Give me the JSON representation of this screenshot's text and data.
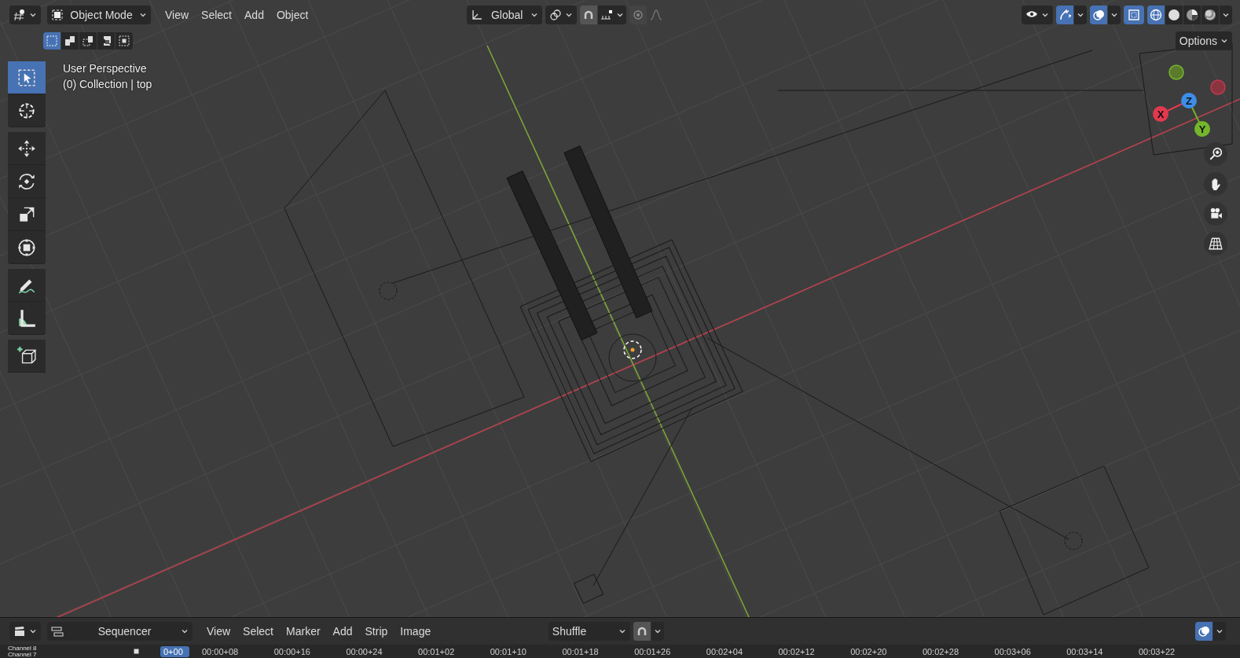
{
  "viewport_header": {
    "mode": "Object Mode",
    "menus": [
      "View",
      "Select",
      "Add",
      "Object"
    ],
    "orientation": "Global",
    "select_modes": [
      {
        "kind": "new",
        "selected": true
      },
      {
        "kind": "extend",
        "selected": false
      },
      {
        "kind": "subtract",
        "selected": false
      },
      {
        "kind": "invert",
        "selected": false
      },
      {
        "kind": "intersect",
        "selected": false
      }
    ],
    "toggles": [
      {
        "kind": "gizmos",
        "on": true
      },
      {
        "kind": "overlays",
        "on": true
      },
      {
        "kind": "xray",
        "on": true
      }
    ],
    "shading": [
      {
        "kind": "wireframe",
        "selected": true
      },
      {
        "kind": "solid",
        "selected": false
      },
      {
        "kind": "material",
        "selected": false
      },
      {
        "kind": "rendered",
        "selected": false
      }
    ],
    "options": "Options"
  },
  "tools": [
    {
      "kind": "select-box",
      "selected": true
    },
    {
      "kind": "cursor",
      "selected": false
    },
    {
      "kind": "move",
      "selected": false
    },
    {
      "kind": "rotate",
      "selected": false
    },
    {
      "kind": "scale",
      "selected": false
    },
    {
      "kind": "transform",
      "selected": false
    },
    {
      "kind": "annotate",
      "selected": false
    },
    {
      "kind": "measure",
      "selected": false
    },
    {
      "kind": "add-cube",
      "selected": false
    }
  ],
  "viewport_info": [
    "User Perspective",
    "(0) Collection | top"
  ],
  "gizmo_axes": [
    {
      "label": "X",
      "color": "#e2394f"
    },
    {
      "label": "Z",
      "color": "#3c8ee8"
    },
    {
      "label": "Y",
      "color": "#74b62c"
    }
  ],
  "sequencer_header": {
    "editor": "Sequencer",
    "menus": [
      "View",
      "Select",
      "Marker",
      "Add",
      "Strip",
      "Image"
    ],
    "snap_mode": "Shuffle",
    "overlays_on": true
  },
  "timeline": {
    "channels": [
      "Channel 8",
      "Channel 7"
    ],
    "current_frame": "0+00",
    "ticks": [
      "00:00+08",
      "00:00+16",
      "00:00+24",
      "00:01+02",
      "00:01+10",
      "00:01+18",
      "00:01+26",
      "00:02+04",
      "00:02+12",
      "00:02+20",
      "00:02+28",
      "00:03+06",
      "00:03+14",
      "00:03+22"
    ]
  }
}
